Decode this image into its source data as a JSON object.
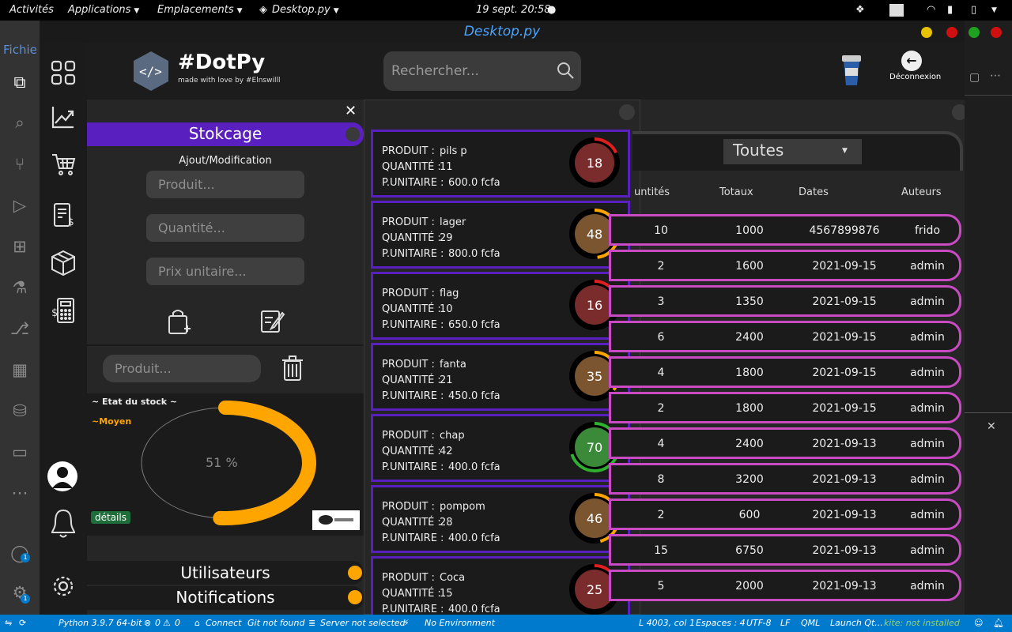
{
  "gnome": {
    "activities": "Activités",
    "applications": "Applications",
    "places": "Emplacements",
    "app_name": "Desktop.py",
    "clock": "19 sept. 20:58"
  },
  "vscode": {
    "menu_partial": "Fichie",
    "status": {
      "python": "Python 3.9.7 64-bit",
      "errors": "0",
      "warnings": "0",
      "connect": "Connect",
      "git": "Git not found",
      "server": "Server not selected",
      "env": "No Environment",
      "position": "L 4003, col 1",
      "spaces": "Espaces : 4",
      "encoding": "UTF-8",
      "eol": "LF",
      "lang": "QML",
      "launch": "Launch Qt...",
      "kite": "kite: not installed"
    },
    "badge": "1"
  },
  "window": {
    "title": "Desktop.py",
    "dot_colors": [
      "#e6c200",
      "#d01010",
      "#20a020",
      "#d01010"
    ]
  },
  "header": {
    "brand": "#DotPy",
    "tagline": "made with love by #Elnswilll",
    "search_placeholder": "Rechercher...",
    "logout_label": "Déconnexion"
  },
  "stock_panel": {
    "section_title": "Stokcage",
    "subtitle": "Ajout/Modification",
    "product_placeholder": "Produit...",
    "quantity_placeholder": "Quantité...",
    "price_placeholder": "Prix unitaire...",
    "delete_placeholder": "Produit...",
    "gauge_title": "~ Etat du stock ~",
    "gauge_state": "~Moyen",
    "gauge_percent_label": "51 %",
    "gauge_fraction": 0.51,
    "details_label": "détails",
    "users_label": "Utilisateurs",
    "notifications_label": "Notifications",
    "accent": "#5a1fbf",
    "gauge_color": "#ffa500"
  },
  "labels": {
    "product": "PRODUIT :",
    "quantity": "QUANTITÉ :",
    "unit_price": "P.UNITAIRE :"
  },
  "products": [
    {
      "name": "pils p",
      "qty": "11",
      "price": "600.0 fcfa",
      "score": "18",
      "level": 18,
      "fill": "#7a2b2b",
      "ring": "#e02020"
    },
    {
      "name": "lager",
      "qty": "29",
      "price": "800.0 fcfa",
      "score": "48",
      "level": 48,
      "fill": "#7a5530",
      "ring": "#ffa500"
    },
    {
      "name": "flag",
      "qty": "10",
      "price": "650.0 fcfa",
      "score": "16",
      "level": 16,
      "fill": "#7a2b2b",
      "ring": "#e02020"
    },
    {
      "name": "fanta",
      "qty": "21",
      "price": "450.0 fcfa",
      "score": "35",
      "level": 35,
      "fill": "#7a5530",
      "ring": "#ffa500"
    },
    {
      "name": "chap",
      "qty": "42",
      "price": "400.0 fcfa",
      "score": "70",
      "level": 70,
      "fill": "#3a8a3a",
      "ring": "#30b030"
    },
    {
      "name": "pompom",
      "qty": "28",
      "price": "400.0 fcfa",
      "score": "46",
      "level": 46,
      "fill": "#7a5530",
      "ring": "#ffa500"
    },
    {
      "name": "Coca",
      "qty": "15",
      "price": "400.0 fcfa",
      "score": "25",
      "level": 25,
      "fill": "#7a2b2b",
      "ring": "#e02020"
    }
  ],
  "table": {
    "filter_value": "Toutes",
    "headers": [
      "untités",
      "Totaux",
      "Dates",
      "Auteurs"
    ],
    "rows": [
      [
        "10",
        "1000",
        "4567899876",
        "frido"
      ],
      [
        "2",
        "1600",
        "2021-09-15",
        "admin"
      ],
      [
        "3",
        "1350",
        "2021-09-15",
        "admin"
      ],
      [
        "6",
        "2400",
        "2021-09-15",
        "admin"
      ],
      [
        "4",
        "1800",
        "2021-09-15",
        "admin"
      ],
      [
        "2",
        "1800",
        "2021-09-15",
        "admin"
      ],
      [
        "4",
        "2400",
        "2021-09-13",
        "admin"
      ],
      [
        "8",
        "3200",
        "2021-09-13",
        "admin"
      ],
      [
        "2",
        "600",
        "2021-09-13",
        "admin"
      ],
      [
        "15",
        "6750",
        "2021-09-13",
        "admin"
      ],
      [
        "5",
        "2000",
        "2021-09-13",
        "admin"
      ]
    ],
    "row_border": "#c94bc4"
  }
}
